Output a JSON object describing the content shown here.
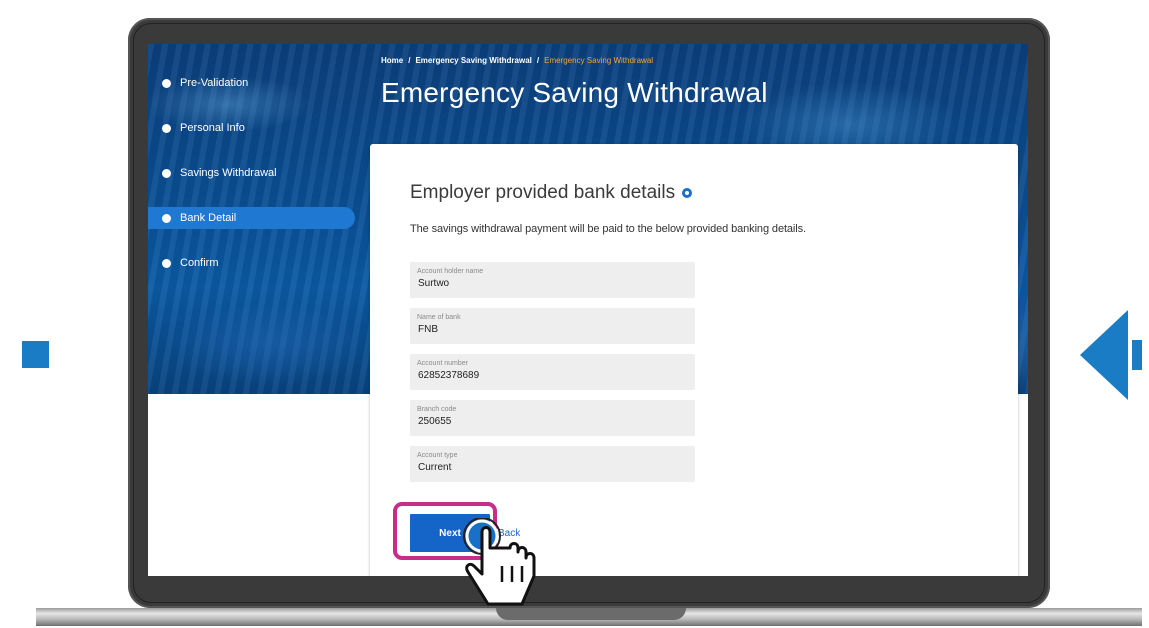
{
  "sidebar": {
    "steps": [
      {
        "label": "Pre-Validation",
        "active": false
      },
      {
        "label": "Personal Info",
        "active": false
      },
      {
        "label": "Savings Withdrawal",
        "active": false
      },
      {
        "label": "Bank Detail",
        "active": true
      },
      {
        "label": "Confirm",
        "active": false
      }
    ]
  },
  "breadcrumb": {
    "home": "Home",
    "section": "Emergency Saving Withdrawal",
    "current": "Emergency Saving Withdrawal",
    "separator": "/"
  },
  "page": {
    "title": "Emergency Saving Withdrawal"
  },
  "card": {
    "title": "Employer provided bank details",
    "info_icon": "info-icon",
    "description": "The savings withdrawal payment will be paid to the below provided banking details.",
    "fields": [
      {
        "label": "Account holder name",
        "value": "Surtwo"
      },
      {
        "label": "Name of bank",
        "value": "FNB"
      },
      {
        "label": "Account number",
        "value": "62852378689"
      },
      {
        "label": "Branch code",
        "value": "250655"
      },
      {
        "label": "Account type",
        "value": "Current"
      }
    ],
    "next_label": "Next",
    "back_label": "Back"
  },
  "colors": {
    "primary": "#1565c9",
    "active_step": "#1f78d1",
    "breadcrumb_current": "#f0a63a",
    "highlight": "#c72e8c",
    "accent_shape": "#1a7cc4"
  },
  "icons": [
    "info-icon",
    "hand-cursor-icon",
    "step-dot-icon"
  ]
}
